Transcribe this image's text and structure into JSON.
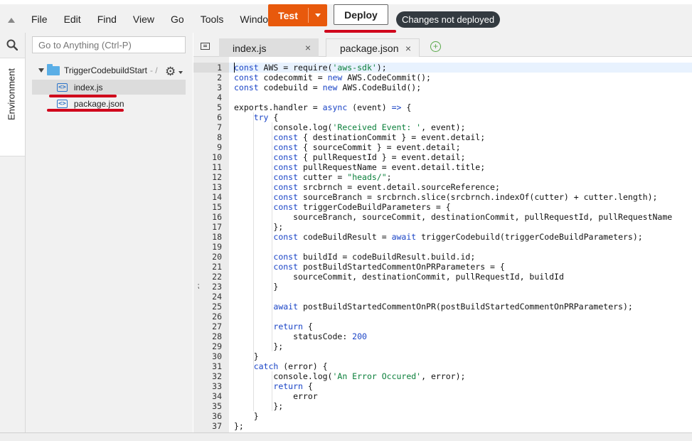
{
  "menu": [
    "File",
    "Edit",
    "Find",
    "View",
    "Go",
    "Tools",
    "Window"
  ],
  "toolbar": {
    "test_label": "Test",
    "deploy_label": "Deploy",
    "status_badge": "Changes not deployed"
  },
  "rail": {
    "tab_label": "Environment"
  },
  "tree": {
    "search_placeholder": "Go to Anything (Ctrl-P)",
    "folder_name": "TriggerCodebuildStart",
    "folder_suffix": "- /",
    "files": [
      "index.js",
      "package.json"
    ]
  },
  "tabs": [
    {
      "label": "index.js",
      "close": "×"
    },
    {
      "label": "package.json",
      "close": "×"
    }
  ],
  "tab_add": "+",
  "colors": {
    "accent_orange": "#e8590c",
    "annotation_red": "#d0021b",
    "badge_dark": "#333a40",
    "keyword_blue": "#1a44c6",
    "string_green": "#0a7f3a"
  },
  "code_lines": [
    "[[const]] AWS = require({{'aws-sdk'}});",
    "[[const]] codecommit = [[new]] AWS.CodeCommit();",
    "[[const]] codebuild = [[new]] AWS.CodeBuild();",
    "",
    "exports.handler = [[async]] (event) [[=>]] {",
    "    [[try]] {",
    "        console.log({{'Received Event: '}}, event);",
    "        [[const]] { destinationCommit } = event.detail;",
    "        [[const]] { sourceCommit } = event.detail;",
    "        [[const]] { pullRequestId } = event.detail;",
    "        [[const]] pullRequestName = event.detail.title;",
    "        [[const]] cutter = {{\"heads/\"}};",
    "        [[const]] srcbrnch = event.detail.sourceReference;",
    "        [[const]] sourceBranch = srcbrnch.slice(srcbrnch.indexOf(cutter) + cutter.length);",
    "        [[const]] triggerCodeBuildParameters = {",
    "            sourceBranch, sourceCommit, destinationCommit, pullRequestId, pullRequestName",
    "        };",
    "        [[const]] codeBuildResult = [[await]] triggerCodebuild(triggerCodeBuildParameters);",
    "",
    "        [[const]] buildId = codeBuildResult.build.id;",
    "        [[const]] postBuildStartedCommentOnPRParameters = {",
    "            sourceCommit, destinationCommit, pullRequestId, buildId",
    "        }",
    "",
    "        [[await]] postBuildStartedCommentOnPR(postBuildStartedCommentOnPRParameters);",
    "",
    "        [[return]] {",
    "            statusCode: ##200##",
    "        };",
    "    }",
    "    [[catch]] (error) {",
    "        console.log({{'An Error Occured'}}, error);",
    "        [[return]] {",
    "            error",
    "        };",
    "    }",
    "};"
  ]
}
